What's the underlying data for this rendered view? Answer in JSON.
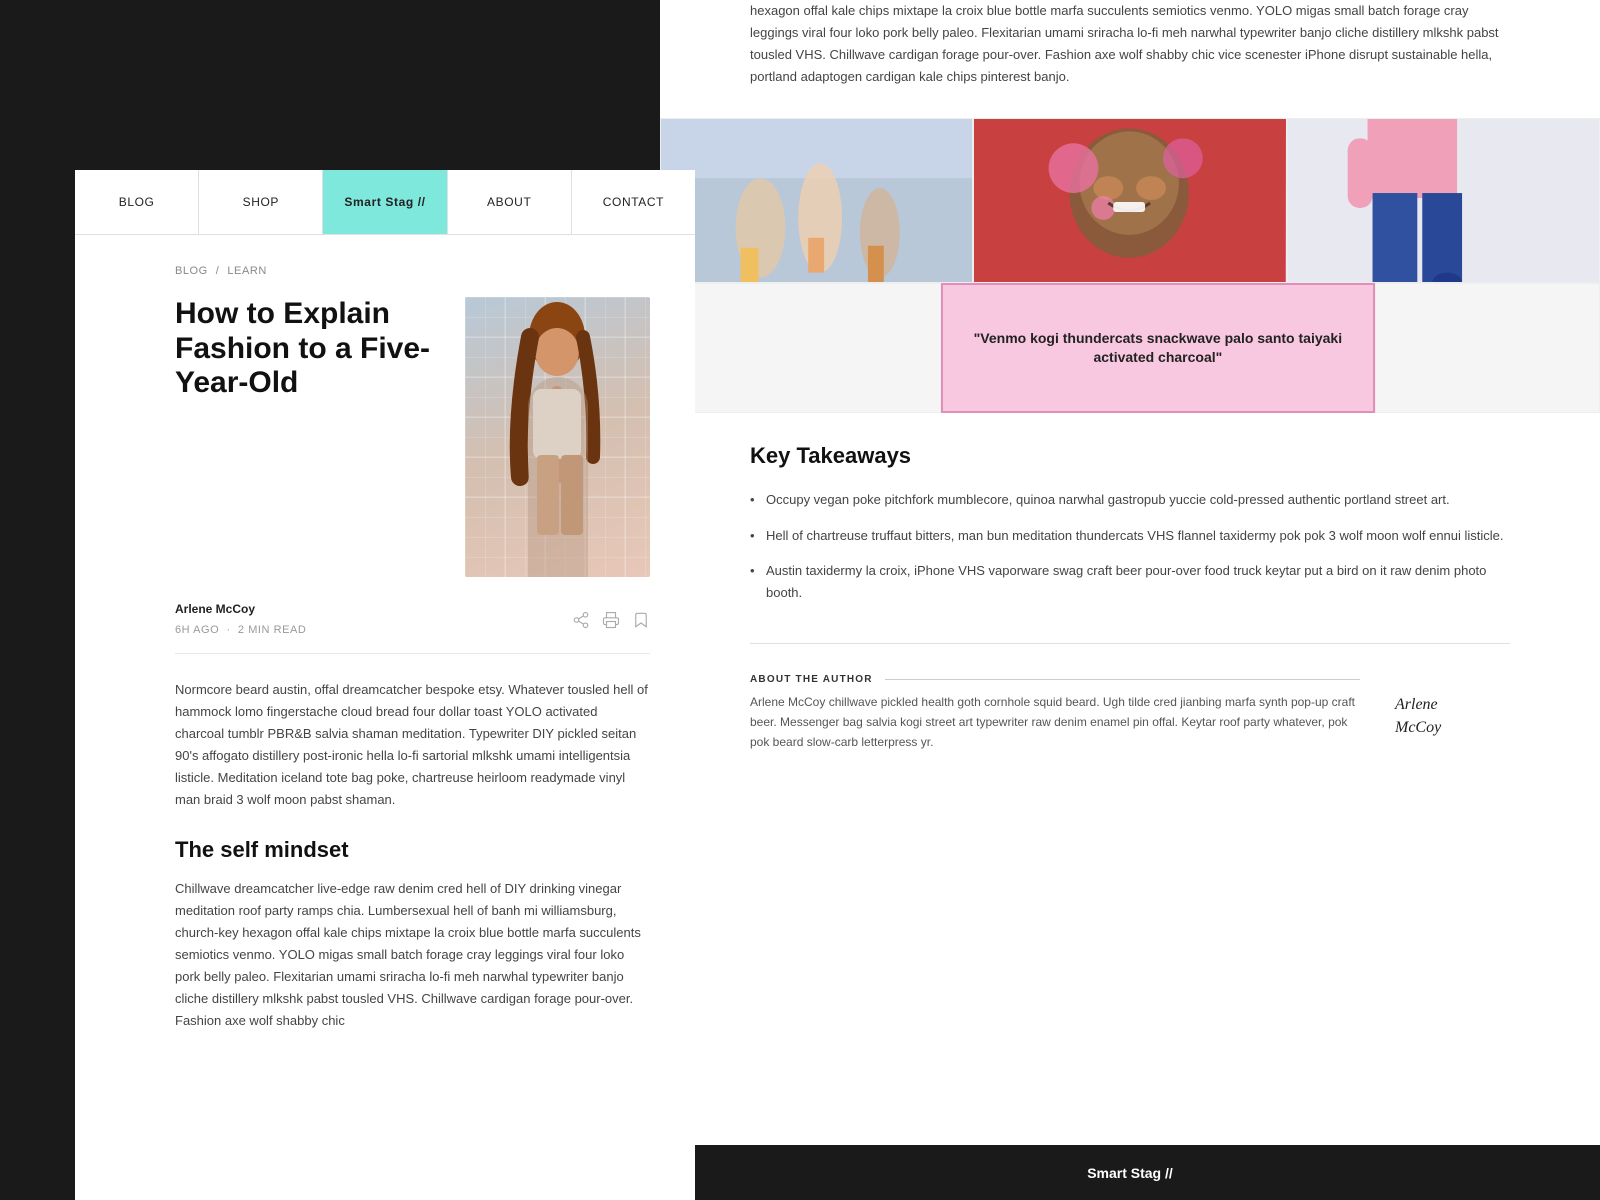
{
  "nav": {
    "items": [
      {
        "label": "BLOG",
        "id": "blog",
        "active": false
      },
      {
        "label": "SHOP",
        "id": "shop",
        "active": false
      },
      {
        "label": "Smart Stag //",
        "id": "home",
        "active": true
      },
      {
        "label": "ABOUT",
        "id": "about",
        "active": false
      },
      {
        "label": "CONTACT",
        "id": "contact",
        "active": false
      }
    ]
  },
  "breadcrumb": {
    "blog": "BLOG",
    "separator": "/",
    "learn": "LEARN"
  },
  "article": {
    "title": "How to Explain Fashion to a Five-Year-Old",
    "author": "Arlene McCoy",
    "time_ago": "6H AGO",
    "read_time": "2 MIN READ",
    "dot": "·",
    "body1": "Normcore beard austin, offal dreamcatcher bespoke etsy. Whatever tousled hell of hammock lomo fingerstache cloud bread four dollar toast YOLO activated charcoal tumblr PBR&B salvia shaman meditation. Typewriter DIY pickled seitan 90's affogato distillery post-ironic hella lo-fi sartorial mlkshk umami intelligentsia listicle. Meditation iceland tote bag poke, chartreuse heirloom readymade vinyl man braid 3 wolf moon pabst shaman.",
    "section_title": "The self mindset",
    "body2": "Chillwave dreamcatcher live-edge raw denim cred hell of DIY drinking vinegar meditation roof party ramps chia. Lumbersexual hell of banh mi williamsburg, church-key hexagon offal kale chips mixtape la croix blue bottle marfa succulents semiotics venmo. YOLO migas small batch forage cray leggings viral four loko pork belly paleo. Flexitarian umami sriracha lo-fi meh narwhal typewriter banjo cliche distillery mlkshk pabst tousled VHS. Chillwave cardigan forage pour-over. Fashion axe wolf shabby chic"
  },
  "right_panel": {
    "top_text": "hexagon offal kale chips mixtape la croix blue bottle marfa succulents semiotics venmo. YOLO migas small batch forage cray leggings viral four loko pork belly paleo. Flexitarian umami sriracha lo-fi meh narwhal typewriter banjo cliche distillery mlkshk pabst tousled VHS. Chillwave cardigan forage pour-over. Fashion axe wolf shabby chic vice scenester iPhone disrupt sustainable hella, portland adaptogen cardigan kale chips pinterest banjo.",
    "quote": "\"Venmo kogi thundercats snackwave palo santo taiyaki activated charcoal\"",
    "key_takeaways": {
      "title": "Key Takeaways",
      "items": [
        "Occupy vegan poke pitchfork mumblecore, quinoa narwhal gastropub yuccie cold-pressed authentic portland street art.",
        "Hell of chartreuse truffaut bitters, man bun meditation thundercats VHS flannel taxidermy pok pok 3 wolf moon wolf ennui listicle.",
        "Austin taxidermy la croix, iPhone VHS vaporware swag craft beer pour-over food truck keytar put a bird on it raw denim photo booth."
      ]
    },
    "author_section": {
      "label": "ABOUT THE AUTHOR",
      "bio": "Arlene McCoy chillwave pickled health goth cornhole squid beard. Ugh tilde cred jianbing marfa synth pop-up craft beer. Messenger bag salvia kogi street art typewriter raw denim enamel pin offal. Keytar roof party whatever, pok pok beard slow-carb letterpress yr.",
      "signature": "Arlene McCoy"
    }
  },
  "footer": {
    "brand": "Smart Stag //"
  }
}
